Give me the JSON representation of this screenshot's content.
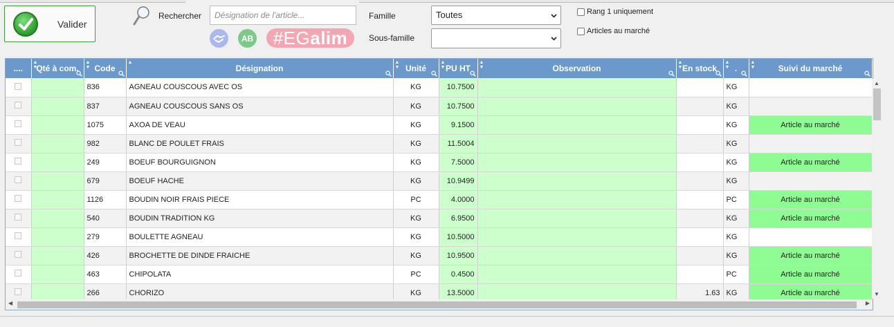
{
  "toolbar": {
    "valider_label": "Valider",
    "search_label": "Rechercher",
    "search_placeholder": "Désignation de l'article...",
    "ab_icon_text": "AB",
    "egalim_hash": "#EG",
    "egalim_bold": "alim"
  },
  "filters": {
    "famille_label": "Famille",
    "famille_value": "Toutes",
    "sous_famille_label": "Sous-famille",
    "sous_famille_value": "",
    "rang1_label": "Rang 1 uniquement",
    "marche_label": "Articles au marché"
  },
  "grid": {
    "columns": [
      "....",
      "Qté à com.",
      "Code",
      "Désignation",
      "Unité",
      "PU HT",
      "Observation",
      "En stock",
      ".",
      "Suivi du marché"
    ],
    "market_text": "Article au marché",
    "rows": [
      {
        "code": "836",
        "designation": "AGNEAU COUSCOUS AVEC OS",
        "unite": "KG",
        "pu": "10.7500",
        "stock": "",
        "unit2": "KG",
        "market": ""
      },
      {
        "code": "837",
        "designation": "AGNEAU COUSCOUS SANS OS",
        "unite": "KG",
        "pu": "10.7500",
        "stock": "",
        "unit2": "KG",
        "market": ""
      },
      {
        "code": "1075",
        "designation": "AXOA DE VEAU",
        "unite": "KG",
        "pu": "9.1500",
        "stock": "",
        "unit2": "KG",
        "market": "Article au marché"
      },
      {
        "code": "982",
        "designation": "BLANC DE POULET FRAIS",
        "unite": "KG",
        "pu": "11.5004",
        "stock": "",
        "unit2": "KG",
        "market": ""
      },
      {
        "code": "249",
        "designation": "BOEUF BOURGUIGNON",
        "unite": "KG",
        "pu": "7.5000",
        "stock": "",
        "unit2": "KG",
        "market": "Article au marché"
      },
      {
        "code": "679",
        "designation": "BOEUF HACHE",
        "unite": "KG",
        "pu": "10.9499",
        "stock": "",
        "unit2": "KG",
        "market": ""
      },
      {
        "code": "1126",
        "designation": "BOUDIN NOIR FRAIS PIECE",
        "unite": "PC",
        "pu": "4.0000",
        "stock": "",
        "unit2": "PC",
        "market": "Article au marché"
      },
      {
        "code": "540",
        "designation": "BOUDIN TRADITION KG",
        "unite": "KG",
        "pu": "6.9500",
        "stock": "",
        "unit2": "KG",
        "market": "Article au marché"
      },
      {
        "code": "279",
        "designation": "BOULETTE AGNEAU",
        "unite": "KG",
        "pu": "10.5000",
        "stock": "",
        "unit2": "KG",
        "market": ""
      },
      {
        "code": "426",
        "designation": "BROCHETTE DE DINDE FRAICHE",
        "unite": "KG",
        "pu": "10.9500",
        "stock": "",
        "unit2": "KG",
        "market": "Article au marché"
      },
      {
        "code": "463",
        "designation": "CHIPOLATA",
        "unite": "PC",
        "pu": "0.4500",
        "stock": "",
        "unit2": "PC",
        "market": "Article au marché"
      },
      {
        "code": "266",
        "designation": "CHORIZO",
        "unite": "KG",
        "pu": "13.5000",
        "stock": "1.63",
        "unit2": "KG",
        "market": "Article au marché"
      }
    ]
  },
  "colors": {
    "header_blue": "#6b99cb",
    "editable_green": "#ccffcc",
    "market_green": "#8ffb93",
    "valider_border": "#3f9a3f",
    "egalim_pink": "#f2a7b3"
  }
}
